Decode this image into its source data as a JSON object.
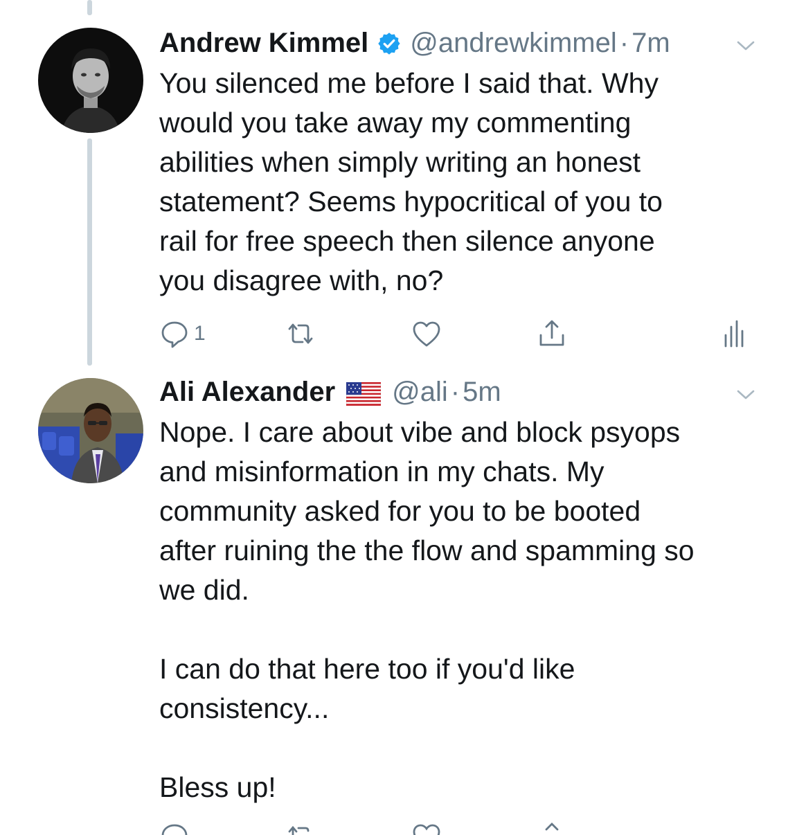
{
  "tweets": [
    {
      "display_name": "Andrew Kimmel",
      "verified": true,
      "handle": "@andrewkimmel",
      "separator": "·",
      "time": "7m",
      "text": "You silenced me before I said that. Why\nwould you take away my commenting\nabilities when simply writing an honest\nstatement? Seems hypocritical of you to\nrail for free speech then silence anyone\nyou disagree with, no?",
      "actions": {
        "reply_count": "1",
        "retweet_count": "",
        "like_count": ""
      }
    },
    {
      "display_name": "Ali Alexander",
      "flag_icon": "us-flag-icon",
      "handle": "@ali",
      "separator": "·",
      "time": "5m",
      "text": "Nope. I care about vibe and block psyops\nand misinformation in my chats. My\ncommunity asked for you to be booted\nafter ruining the the flow and spamming so\nwe did.\n\nI can do that here too if you'd like\nconsistency...\n\nBless up!"
    }
  ],
  "icons": {
    "verified": "verified-badge-icon",
    "caret": "chevron-down-icon",
    "reply": "reply-icon",
    "retweet": "retweet-icon",
    "like": "heart-icon",
    "share": "share-icon",
    "analytics": "analytics-icon"
  },
  "colors": {
    "icon_gray": "#657786",
    "verified_blue": "#1da1f2",
    "thread_line": "#ccd6dd",
    "text": "#14171a"
  }
}
